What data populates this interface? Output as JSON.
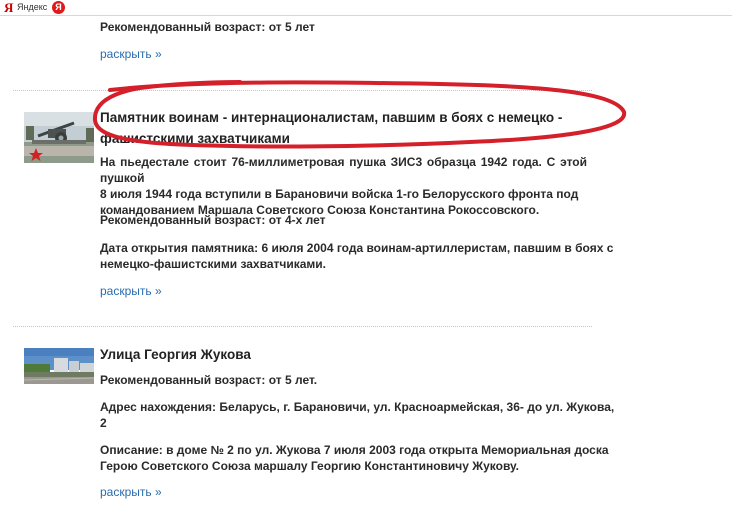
{
  "browser": {
    "bookmark_text": "Яндекс"
  },
  "items": [
    {
      "age": "Рекомендованный возраст: от 5 лет",
      "expand": "раскрыть »"
    },
    {
      "title_line1": "Памятник воинам - интернационалистам, павшим в боях с немецко -",
      "title_line2": "фашистскими захватчиками",
      "desc_line1": "На пьедестале стоит 76-миллиметровая пушка ЗИС3 образца 1942 года. С этой пушкой",
      "desc_line2": "8 июля 1944 года вступили в Барановичи войска 1-го Белорусского фронта под",
      "desc_line3": "командованием Маршала Советского Союза Константина Рокоссовского.",
      "age": "Рекомендованный возраст: от 4-х лет",
      "open_line1": "Дата открытия памятника: 6 июля 2004 года воинам-артиллеристам, павшим в боях с",
      "open_line2": "немецко-фашистскими захватчиками.",
      "expand": "раскрыть »"
    },
    {
      "title": "Улица Георгия Жукова",
      "age": "Рекомендованный возраст: от 5 лет.",
      "address_line1": "Адрес нахождения: Беларусь, г. Барановичи, ул. Красноармейская, 36- до ул. Жукова,",
      "address_line2": "2",
      "desc_line1": "Описание: в доме № 2 по ул. Жукова 7 июля 2003 года открыта Мемориальная доска",
      "desc_line2": "Герою Советского Союза маршалу Георгию Константиновичу Жукову.",
      "expand": "раскрыть »"
    }
  ],
  "colors": {
    "link": "#2a6bb0",
    "annotation": "#d4202a",
    "yandex": "#e01a1a"
  },
  "icons": {
    "yandex_logo": "Я",
    "yandex_circle": "Я"
  }
}
